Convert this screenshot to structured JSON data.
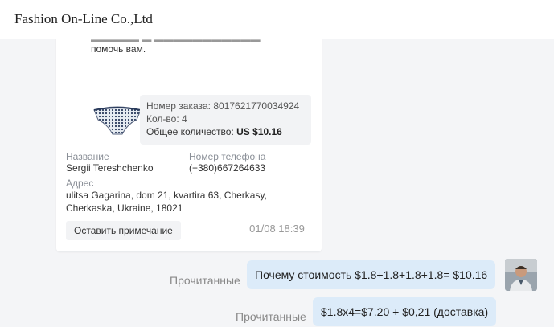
{
  "header": {
    "title": "Fashion On-Line Co.,Ltd"
  },
  "order_card": {
    "cut_text": "помочь вам.",
    "order_number_label": "Номер заказа:",
    "order_number": "8017621770034924",
    "quantity_label": "Кол-во:",
    "quantity": "4",
    "total_label": "Общее количество:",
    "total_value": "US $10.16",
    "name_label": "Название",
    "name_value": "Sergii Tereshchenko",
    "phone_label": "Номер телефона",
    "phone_value": "(+380)667264633",
    "address_label": "Адрес",
    "address_line1": "ulitsa Gagarina, dom 21, kvartira 63, Cherkasy,",
    "address_line2": "Cherkaska, Ukraine, 18021",
    "note_button": "Оставить примечание"
  },
  "timestamp": "01/08 18:39",
  "messages": [
    {
      "status": "Прочитанные",
      "text": "Почему стоимость $1.8+1.8+1.8+1.8= $10.16"
    },
    {
      "status": "Прочитанные",
      "text": "$1.8x4=$7.20 + $0,21 (доставка)"
    }
  ]
}
